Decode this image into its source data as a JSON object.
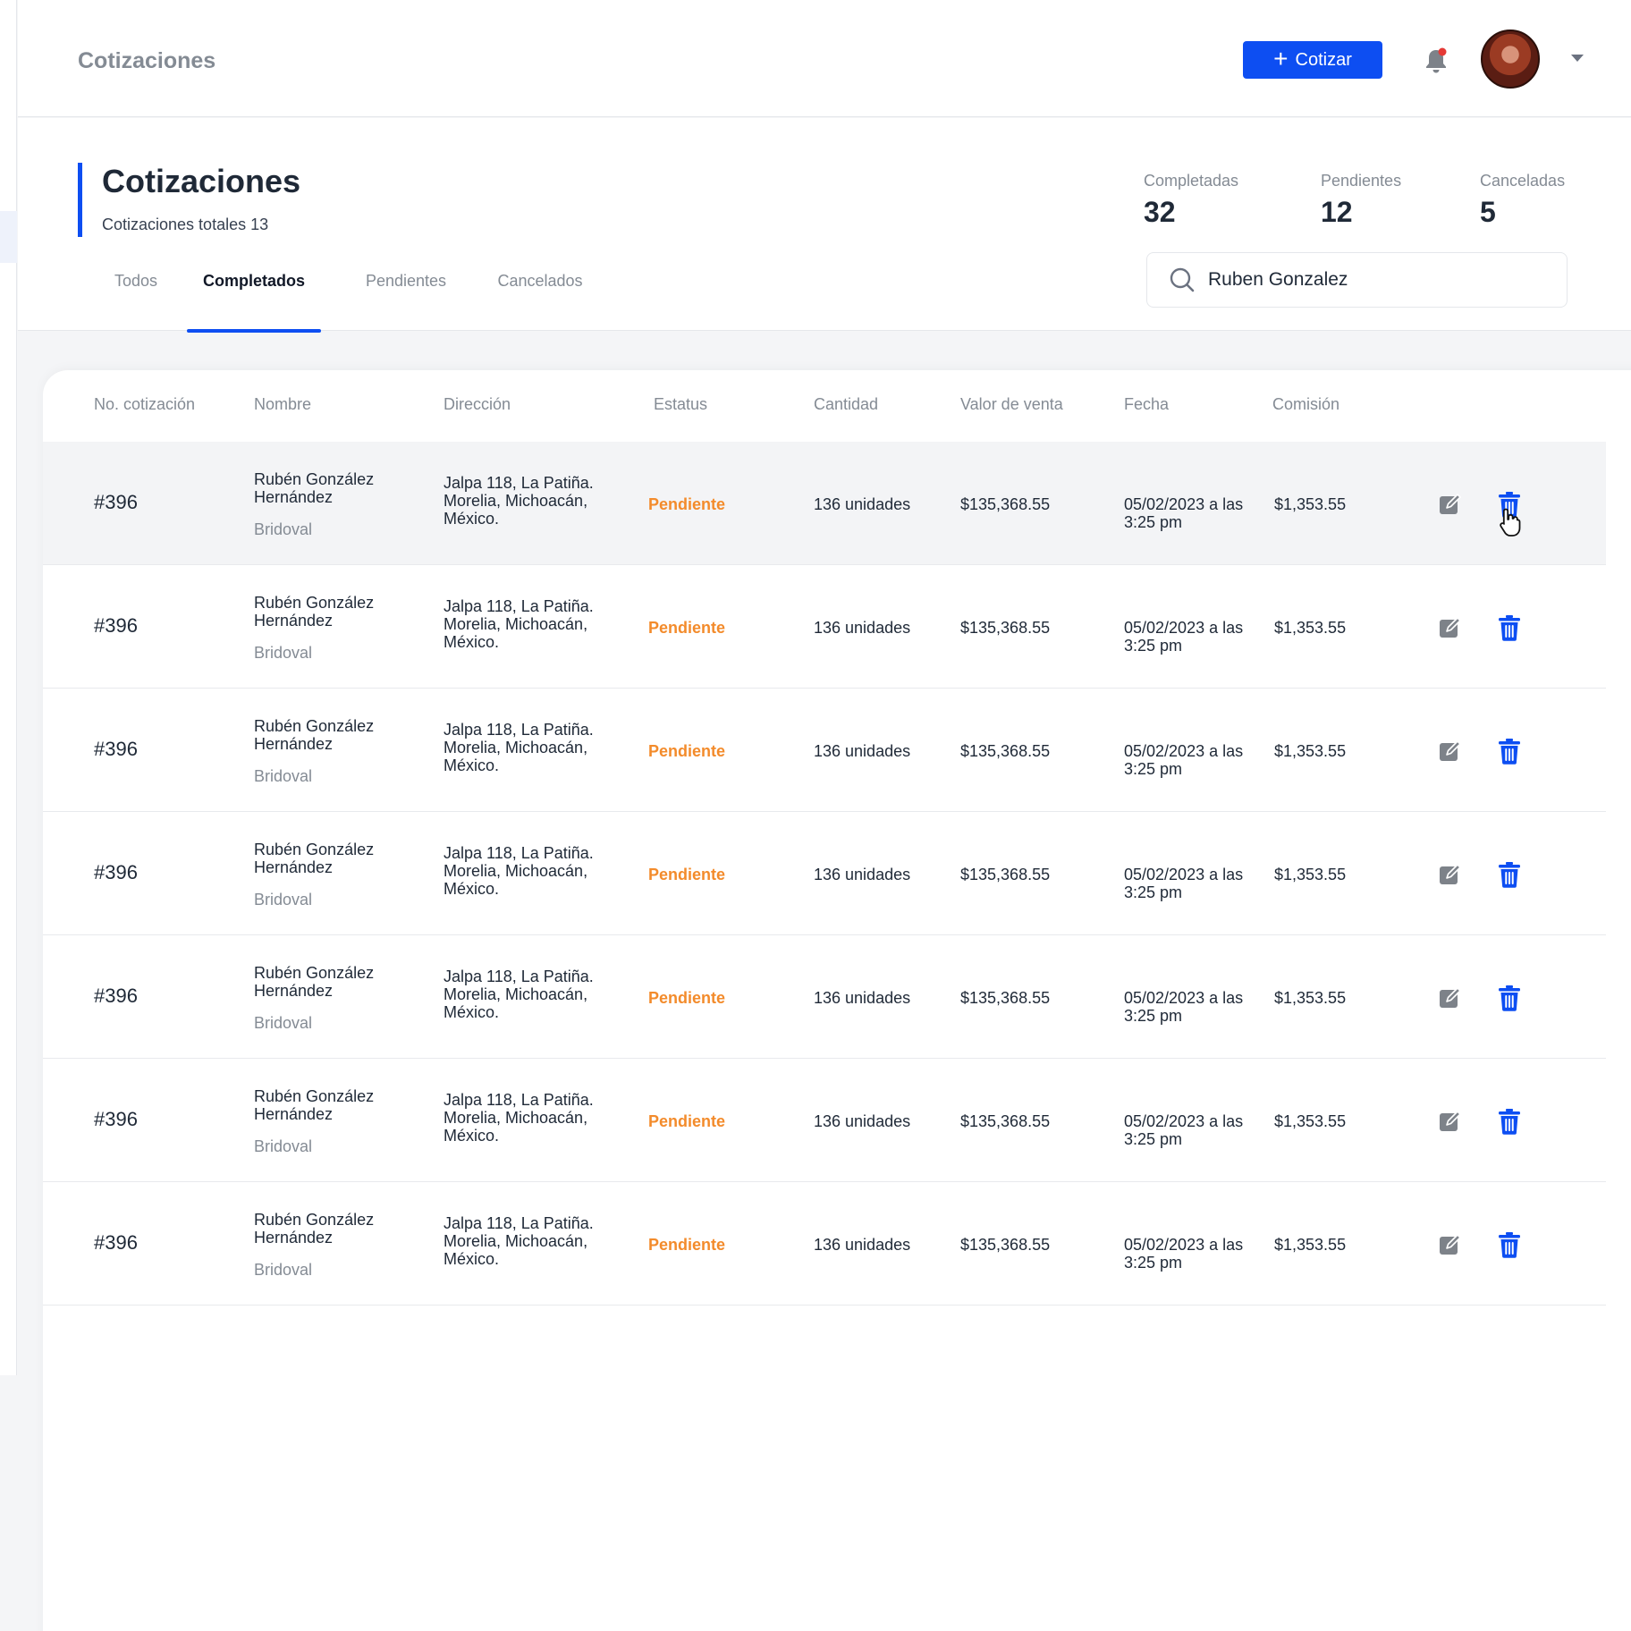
{
  "topbar": {
    "title": "Cotizaciones",
    "cotizar_label": "Cotizar"
  },
  "header": {
    "title": "Cotizaciones",
    "subtitle": "Cotizaciones totales 13"
  },
  "stats": [
    {
      "label": "Completadas",
      "value": "32"
    },
    {
      "label": "Pendientes",
      "value": "12"
    },
    {
      "label": "Canceladas",
      "value": "5"
    }
  ],
  "search": {
    "value": "Ruben Gonzalez"
  },
  "tabs": [
    {
      "label": "Todos"
    },
    {
      "label": "Completados"
    },
    {
      "label": "Pendientes"
    },
    {
      "label": "Cancelados"
    }
  ],
  "active_tab": "Completados",
  "table": {
    "columns": [
      "No. cotización",
      "Nombre",
      "Dirección",
      "Estatus",
      "Cantidad",
      "Valor de venta",
      "Fecha",
      "Comisión"
    ],
    "rows": [
      {
        "id": "#396",
        "name": "Rubén González Hernández",
        "company": "Bridoval",
        "address": "Jalpa 118, La Patiña. Morelia, Michoacán, México.",
        "status": "Pendiente",
        "quantity": "136 unidades",
        "value": "$135,368.55",
        "date": "05/02/2023 a las 3:25 pm",
        "commission": "$1,353.55"
      },
      {
        "id": "#396",
        "name": "Rubén González Hernández",
        "company": "Bridoval",
        "address": "Jalpa 118, La Patiña. Morelia, Michoacán, México.",
        "status": "Pendiente",
        "quantity": "136 unidades",
        "value": "$135,368.55",
        "date": "05/02/2023 a las 3:25 pm",
        "commission": "$1,353.55"
      },
      {
        "id": "#396",
        "name": "Rubén González Hernández",
        "company": "Bridoval",
        "address": "Jalpa 118, La Patiña. Morelia, Michoacán, México.",
        "status": "Pendiente",
        "quantity": "136 unidades",
        "value": "$135,368.55",
        "date": "05/02/2023 a las 3:25 pm",
        "commission": "$1,353.55"
      },
      {
        "id": "#396",
        "name": "Rubén González Hernández",
        "company": "Bridoval",
        "address": "Jalpa 118, La Patiña. Morelia, Michoacán, México.",
        "status": "Pendiente",
        "quantity": "136 unidades",
        "value": "$135,368.55",
        "date": "05/02/2023 a las 3:25 pm",
        "commission": "$1,353.55"
      },
      {
        "id": "#396",
        "name": "Rubén González Hernández",
        "company": "Bridoval",
        "address": "Jalpa 118, La Patiña. Morelia, Michoacán, México.",
        "status": "Pendiente",
        "quantity": "136 unidades",
        "value": "$135,368.55",
        "date": "05/02/2023 a las 3:25 pm",
        "commission": "$1,353.55"
      },
      {
        "id": "#396",
        "name": "Rubén González Hernández",
        "company": "Bridoval",
        "address": "Jalpa 118, La Patiña. Morelia, Michoacán, México.",
        "status": "Pendiente",
        "quantity": "136 unidades",
        "value": "$135,368.55",
        "date": "05/02/2023 a las 3:25 pm",
        "commission": "$1,353.55"
      },
      {
        "id": "#396",
        "name": "Rubén González Hernández",
        "company": "Bridoval",
        "address": "Jalpa 118, La Patiña. Morelia, Michoacán, México.",
        "status": "Pendiente",
        "quantity": "136 unidades",
        "value": "$135,368.55",
        "date": "05/02/2023 a las 3:25 pm",
        "commission": "$1,353.55"
      }
    ],
    "hovered_row": 0
  },
  "icons": {
    "cotizar": "plus-icon",
    "notifications": "bell-icon",
    "search": "search-icon",
    "edit": "edit-icon",
    "delete": "trash-icon",
    "user_menu": "chevron-down-icon"
  },
  "colors": {
    "accent": "#0d4ef2",
    "status_pending": "#f38b2b",
    "notification_dot": "#e53935",
    "muted_text": "#848b94",
    "edit_icon": "#7d8289"
  }
}
